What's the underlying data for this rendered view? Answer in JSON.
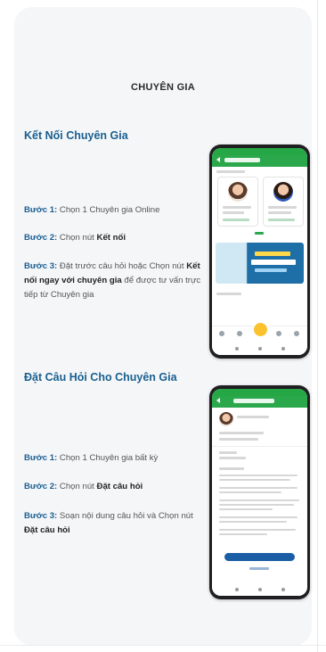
{
  "page": {
    "title": "CHUYÊN GIA"
  },
  "sections": [
    {
      "heading": "Kết Nối Chuyên Gia",
      "steps": [
        {
          "label": "Bước 1:",
          "parts": [
            " Chọn 1 Chuyên gia Online"
          ]
        },
        {
          "label": "Bước 2:",
          "parts": [
            " Chọn nút ",
            "Kết nối"
          ]
        },
        {
          "label": "Bước 3:",
          "parts": [
            " Đặt trước câu hỏi hoặc Chọn nút ",
            "Kết nối ngay với chuyên gia",
            " để được tư vấn trực tiếp từ Chuyên gia"
          ]
        }
      ]
    },
    {
      "heading": "Đặt Câu Hỏi Cho Chuyên Gia",
      "steps": [
        {
          "label": "Bước 1:",
          "parts": [
            " Chọn 1 Chuyên gia bất kỳ"
          ]
        },
        {
          "label": "Bước 2:",
          "parts": [
            " Chọn nút ",
            "Đặt câu hỏi"
          ]
        },
        {
          "label": "Bước 3:",
          "parts": [
            " Soạn nội dung câu hỏi và Chọn nút ",
            "Đặt câu hỏi"
          ]
        }
      ]
    }
  ],
  "colors": {
    "heading": "#19608f",
    "step_label": "#1a5f93",
    "app_green": "#2ca84c",
    "accent_yellow": "#fbc22e",
    "button_blue": "#1c5ea5"
  }
}
